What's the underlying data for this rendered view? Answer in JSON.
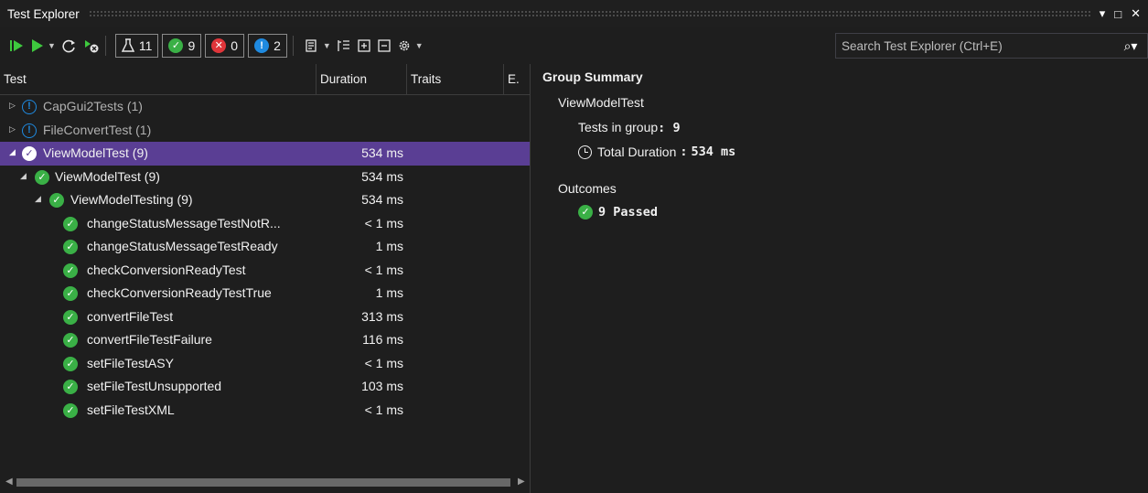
{
  "window": {
    "title": "Test Explorer",
    "pin_glyph": "▾",
    "maximize_glyph": "□",
    "close_glyph": "✕"
  },
  "toolbar": {
    "run_all_icon": "run-all-icon",
    "run_icon": "run-icon",
    "counters": {
      "total": "11",
      "passed": "9",
      "failed": "0",
      "not_run": "2"
    },
    "search_placeholder": "Search Test Explorer (Ctrl+E)"
  },
  "columns": {
    "test": "Test",
    "duration": "Duration",
    "traits": "Traits",
    "error": "E."
  },
  "tree": [
    {
      "name": "CapGui2Tests (1)",
      "duration": "",
      "status": "warning",
      "expanded": false
    },
    {
      "name": "FileConvertTest (1)",
      "duration": "",
      "status": "warning",
      "expanded": false
    },
    {
      "name": "ViewModelTest (9)",
      "duration": "534 ms",
      "status": "passed",
      "expanded": true,
      "selected": true
    },
    {
      "name": "ViewModelTest (9)",
      "duration": "534 ms",
      "status": "passed",
      "expanded": true
    },
    {
      "name": "ViewModelTesting (9)",
      "duration": "534 ms",
      "status": "passed",
      "expanded": true
    },
    {
      "name": "changeStatusMessageTestNotR...",
      "duration": "< 1 ms",
      "status": "passed"
    },
    {
      "name": "changeStatusMessageTestReady",
      "duration": "1 ms",
      "status": "passed"
    },
    {
      "name": "checkConversionReadyTest",
      "duration": "< 1 ms",
      "status": "passed"
    },
    {
      "name": "checkConversionReadyTestTrue",
      "duration": "1 ms",
      "status": "passed"
    },
    {
      "name": "convertFileTest",
      "duration": "313 ms",
      "status": "passed"
    },
    {
      "name": "convertFileTestFailure",
      "duration": "116 ms",
      "status": "passed"
    },
    {
      "name": "setFileTestASY",
      "duration": "< 1 ms",
      "status": "passed"
    },
    {
      "name": "setFileTestUnsupported",
      "duration": "103 ms",
      "status": "passed"
    },
    {
      "name": "setFileTestXML",
      "duration": "< 1 ms",
      "status": "passed"
    }
  ],
  "summary": {
    "heading": "Group Summary",
    "group_name": "ViewModelTest",
    "tests_in_group_label": "Tests in group",
    "tests_in_group_value": "9",
    "total_duration_label": "Total Duration",
    "total_duration_value": "534 ms",
    "outcomes_label": "Outcomes",
    "passed_text": "9 Passed"
  },
  "colors": {
    "selection": "#5a3e94",
    "passed": "#3ab046",
    "failed": "#e0353a",
    "info": "#1f8ae0"
  }
}
